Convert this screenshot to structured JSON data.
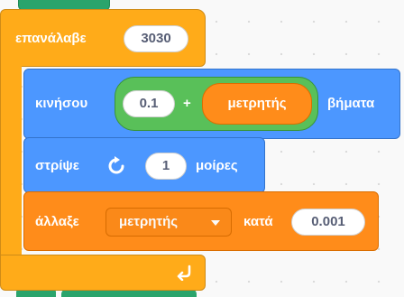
{
  "repeat_block": {
    "label": "επανάλαβε",
    "times": "3030",
    "loop_icon": "loop-arrow-icon"
  },
  "move_block": {
    "label": "κινήσου",
    "suffix": "βήματα",
    "operator": {
      "left_value": "0.1",
      "symbol": "+",
      "right_reporter": "μετρητής"
    }
  },
  "turn_block": {
    "label": "στρίψε",
    "icon": "rotate-clockwise-icon",
    "degrees": "1",
    "suffix": "μοίρες"
  },
  "change_block": {
    "label": "άλλαξε",
    "variable": "μετρητής",
    "by_label": "κατά",
    "amount": "0.001"
  },
  "colors": {
    "control": "#ffab19",
    "motion": "#4c97ff",
    "operator": "#59c059",
    "variables": "#ff8c1a"
  }
}
